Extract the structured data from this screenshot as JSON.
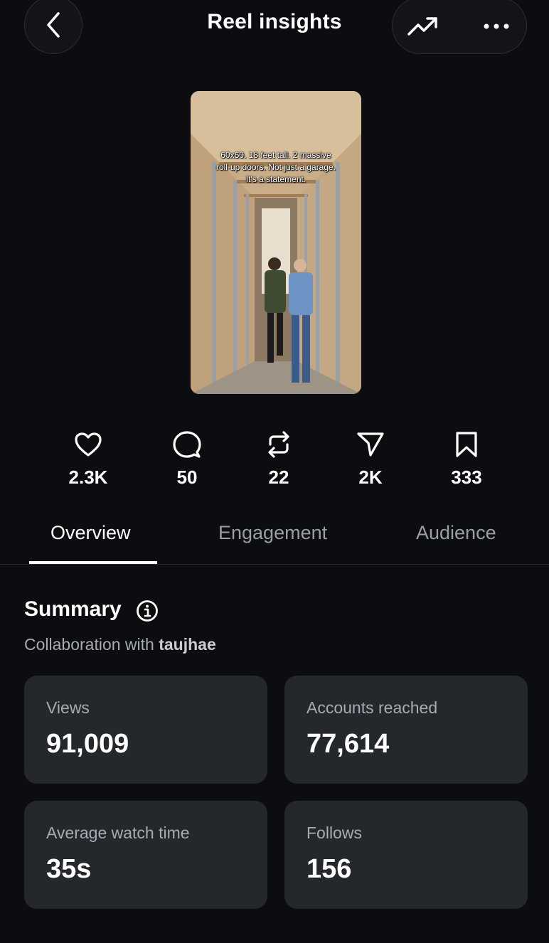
{
  "header": {
    "title": "Reel insights",
    "back_icon": "chevron-left-icon",
    "trend_icon": "trending-up-icon",
    "more_icon": "more-horizontal-icon"
  },
  "reel": {
    "caption_lines": [
      "60x60. 18 feet tall. 2 massive",
      "roll-up doors. Not just a garage.",
      "It's a statement."
    ]
  },
  "stats": [
    {
      "icon": "heart-icon",
      "value": "2.3K"
    },
    {
      "icon": "comment-icon",
      "value": "50"
    },
    {
      "icon": "repost-icon",
      "value": "22"
    },
    {
      "icon": "share-icon",
      "value": "2K"
    },
    {
      "icon": "bookmark-icon",
      "value": "333"
    }
  ],
  "tabs": [
    {
      "label": "Overview",
      "active": true
    },
    {
      "label": "Engagement",
      "active": false
    },
    {
      "label": "Audience",
      "active": false
    }
  ],
  "summary": {
    "title": "Summary",
    "info_icon": "info-icon",
    "collab_prefix": "Collaboration with",
    "collab_user": "taujhae"
  },
  "cards": [
    {
      "label": "Views",
      "value": "91,009"
    },
    {
      "label": "Accounts reached",
      "value": "77,614"
    },
    {
      "label": "Average watch time",
      "value": "35s"
    },
    {
      "label": "Follows",
      "value": "156"
    }
  ],
  "colors": {
    "background": "#0b0d10",
    "card": "#24272c",
    "muted_text": "#a7abb2"
  }
}
